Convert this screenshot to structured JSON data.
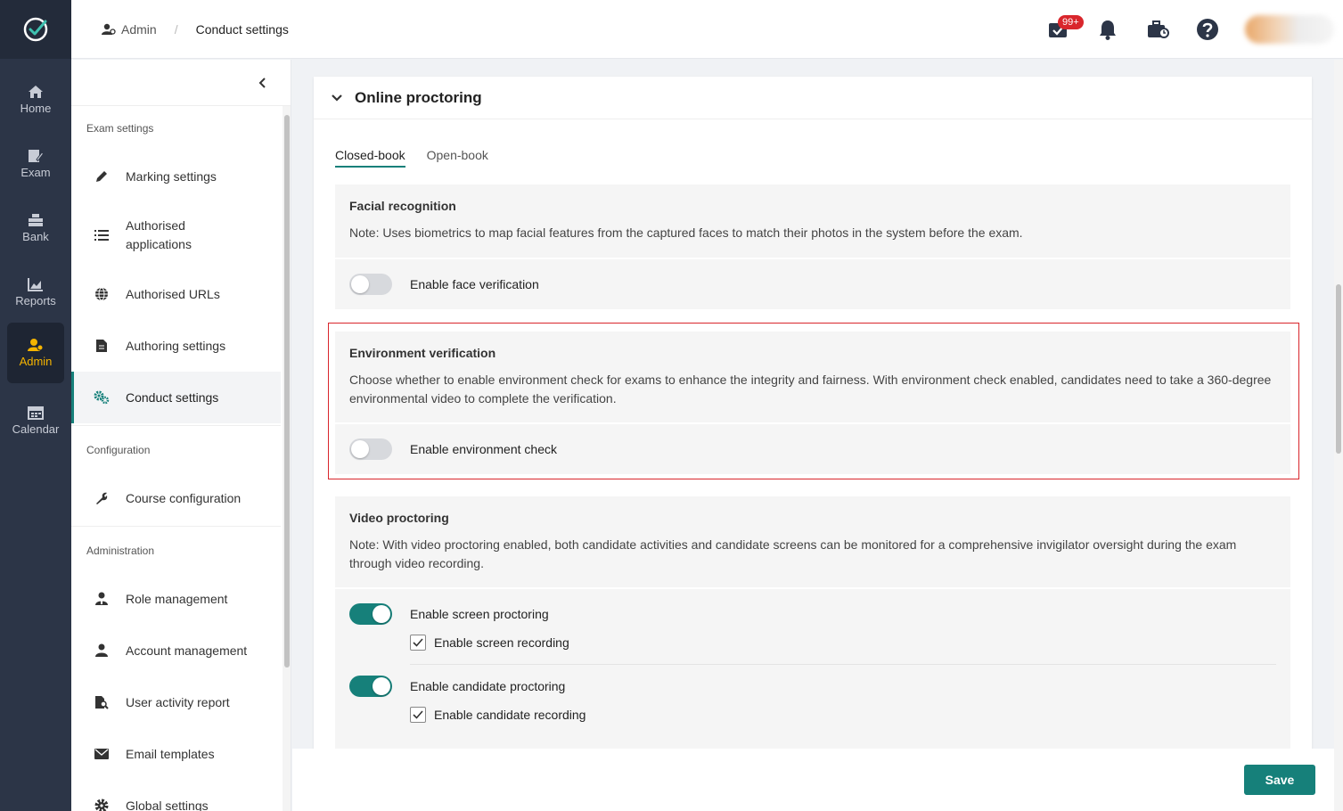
{
  "rail": {
    "items": [
      {
        "label": "Home",
        "icon": "home-icon"
      },
      {
        "label": "Exam",
        "icon": "exam-icon"
      },
      {
        "label": "Bank",
        "icon": "bank-icon"
      },
      {
        "label": "Reports",
        "icon": "reports-icon"
      },
      {
        "label": "Admin",
        "icon": "admin-icon",
        "active": true
      },
      {
        "label": "Calendar",
        "icon": "calendar-icon"
      }
    ],
    "active_color": "#f5b400"
  },
  "breadcrumb": {
    "root": "Admin",
    "current": "Conduct settings"
  },
  "header": {
    "notification_badge": "99+"
  },
  "sidebar": {
    "sections": [
      {
        "title": "Exam settings",
        "items": [
          {
            "label": "Marking settings",
            "icon": "pencil-icon"
          },
          {
            "label": "Authorised applications",
            "icon": "list-icon"
          },
          {
            "label": "Authorised URLs",
            "icon": "globe-icon"
          },
          {
            "label": "Authoring settings",
            "icon": "document-icon"
          },
          {
            "label": "Conduct settings",
            "icon": "gears-icon",
            "active": true
          }
        ]
      },
      {
        "title": "Configuration",
        "items": [
          {
            "label": "Course configuration",
            "icon": "wrench-icon"
          }
        ]
      },
      {
        "title": "Administration",
        "items": [
          {
            "label": "Role management",
            "icon": "role-icon"
          },
          {
            "label": "Account management",
            "icon": "user-icon"
          },
          {
            "label": "User activity report",
            "icon": "report-search-icon"
          },
          {
            "label": "Email templates",
            "icon": "envelope-icon"
          },
          {
            "label": "Global settings",
            "icon": "gear-icon"
          }
        ]
      }
    ]
  },
  "main": {
    "section_title": "Online proctoring",
    "tabs": [
      {
        "label": "Closed-book",
        "active": true
      },
      {
        "label": "Open-book",
        "active": false
      }
    ],
    "facial": {
      "title": "Facial recognition",
      "note": "Note: Uses biometrics to map facial features from the captured faces to match their photos in the system before the exam.",
      "toggle_label": "Enable face verification",
      "toggle_on": false
    },
    "environment": {
      "title": "Environment verification",
      "note": "Choose whether to enable environment check for exams to enhance the integrity and fairness. With environment check enabled, candidates need to take a 360-degree environmental video to complete the verification.",
      "toggle_label": "Enable environment check",
      "toggle_on": false
    },
    "video": {
      "title": "Video proctoring",
      "note": "Note: With video proctoring enabled, both candidate activities and candidate screens can be monitored for a comprehensive invigilator oversight during the exam through video recording.",
      "screen_toggle_label": "Enable screen proctoring",
      "screen_toggle_on": true,
      "screen_recording_label": "Enable screen recording",
      "screen_recording_checked": true,
      "candidate_toggle_label": "Enable candidate proctoring",
      "candidate_toggle_on": true,
      "candidate_recording_label": "Enable candidate recording",
      "candidate_recording_checked": true
    }
  },
  "footer": {
    "save_label": "Save"
  },
  "colors": {
    "accent": "#16807a",
    "highlight_border": "#d9262c",
    "rail_bg": "#2c3547"
  }
}
